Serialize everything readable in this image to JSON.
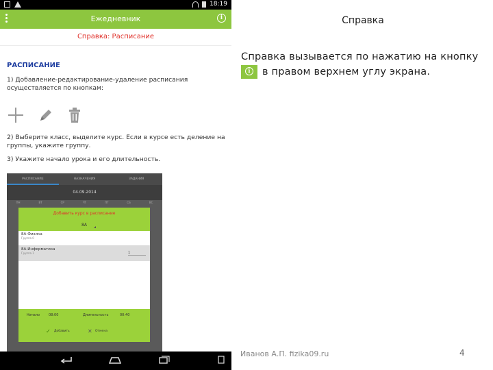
{
  "status_bar": {
    "time": "18:19"
  },
  "app": {
    "title": "Ежедневник",
    "subtitle": "Справка: Расписание"
  },
  "help": {
    "section": "РАСПИСАНИЕ",
    "step1": "1) Добавление-редактирование-удаление расписания осуществляется по кнопкам:",
    "step2": "2) Выберите класс, выделите курс. Если в курсе есть деление на группы, укажите группу.",
    "step3": "3) Укажите начало урока и его длительность."
  },
  "embedded": {
    "tabs": [
      "РАСПИСАНИЕ",
      "НАЗНАЧЕНИЯ",
      "ЗАДАНИЯ"
    ],
    "date": "04.09.2014",
    "weekdays": [
      "ПН",
      "ВТ",
      "СР",
      "ЧТ",
      "ПТ",
      "СБ",
      "ВС"
    ],
    "dialog": {
      "title": "Добавить курс в расписание",
      "class_value": "8А",
      "courses": [
        {
          "name": "8А-Физика",
          "group": "Группа 0",
          "selected": false
        },
        {
          "name": "8А-Информатика",
          "group": "Группа 1",
          "group_num": "1",
          "selected": true
        }
      ],
      "start_label": "Начало",
      "start_value": "08:00",
      "duration_label": "Длительность",
      "duration_value": "00:40",
      "ok_label": "Добавить",
      "cancel_label": "Отмена"
    }
  },
  "slide": {
    "title": "Справка",
    "text_line1": "Справка вызывается по нажатию на кнопку",
    "text_line2": "в правом верхнем углу экрана.",
    "author": "Иванов А.П. fizika09.ru",
    "page_number": "4"
  },
  "colors": {
    "accent_green": "#8dc63f",
    "title_red": "#e0302a",
    "section_blue": "#1f3ea0"
  },
  "icons": [
    "menu-icon",
    "info-icon",
    "plus-icon",
    "pencil-icon",
    "trash-icon",
    "back-icon",
    "home-icon",
    "recent-apps-icon"
  ]
}
